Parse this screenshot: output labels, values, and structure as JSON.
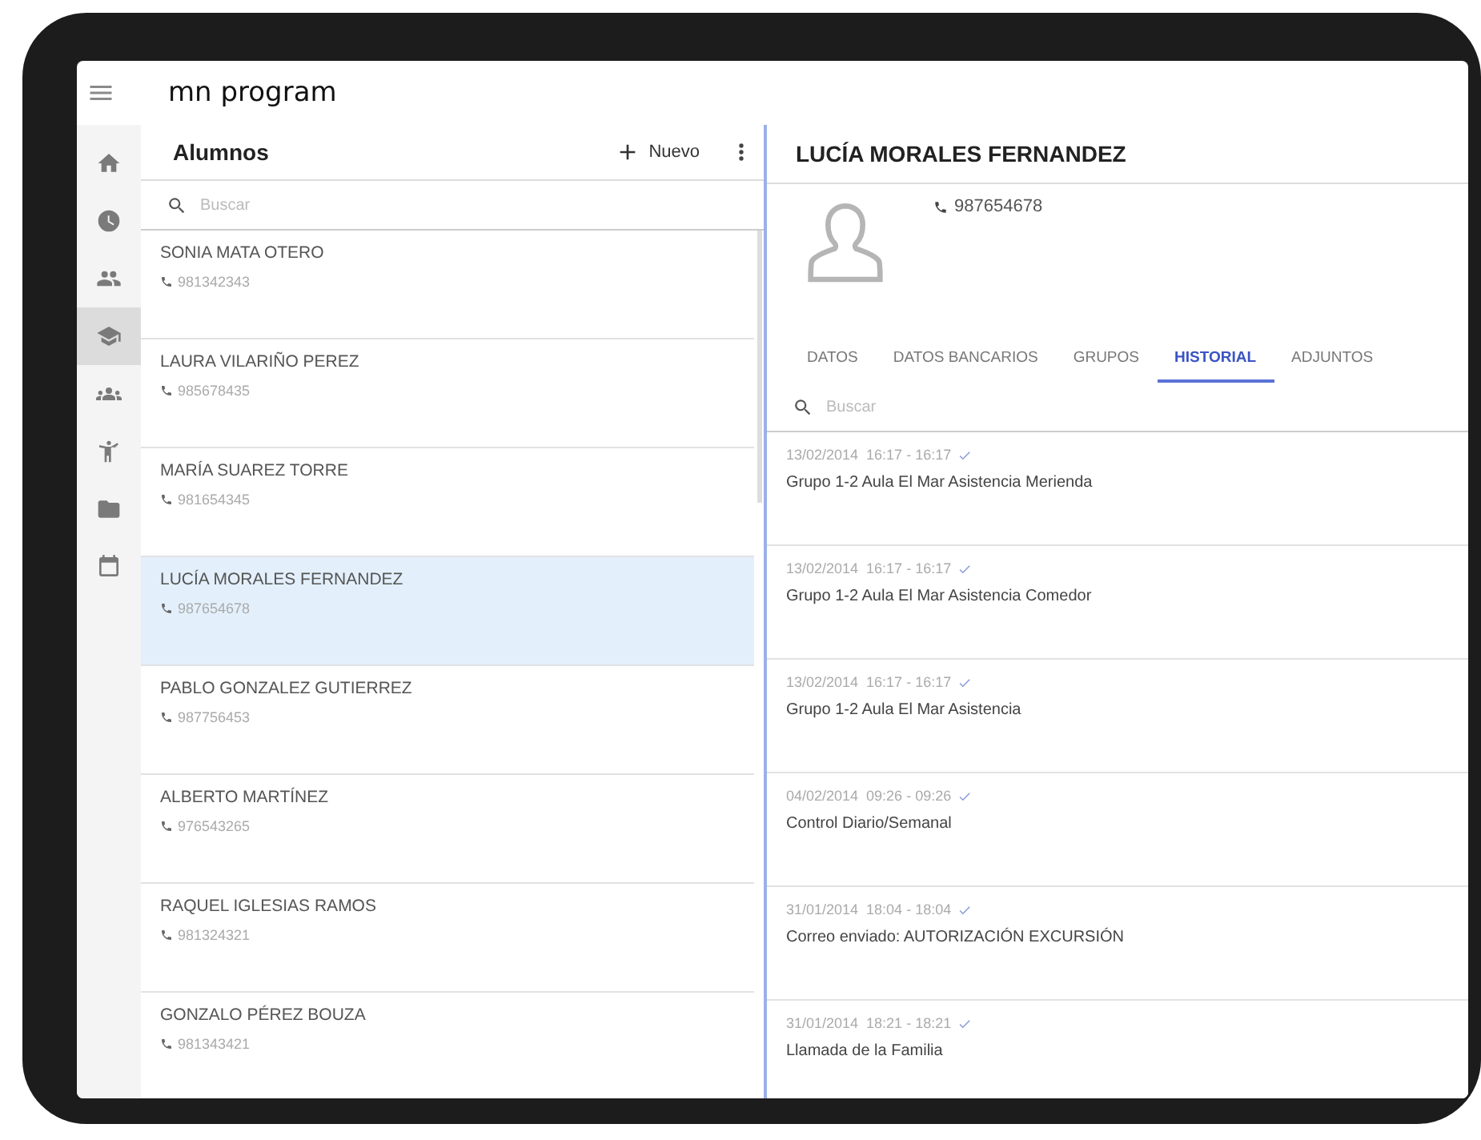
{
  "app": {
    "title": "mn program"
  },
  "rail": [
    {
      "selected": false
    },
    {
      "selected": false
    },
    {
      "selected": false
    },
    {
      "selected": true
    },
    {
      "selected": false
    },
    {
      "selected": false
    },
    {
      "selected": false
    },
    {
      "selected": false
    }
  ],
  "list": {
    "title": "Alumnos",
    "new_button": "Nuevo",
    "search": {
      "placeholder": "Buscar"
    },
    "items": [
      {
        "name": "SONIA MATA OTERO",
        "phone": "981342343",
        "selected": false
      },
      {
        "name": "LAURA VILARIÑO PEREZ",
        "phone": "985678435",
        "selected": false
      },
      {
        "name": "MARÍA SUAREZ TORRE",
        "phone": "981654345",
        "selected": false
      },
      {
        "name": "LUCÍA MORALES FERNANDEZ",
        "phone": "987654678",
        "selected": true
      },
      {
        "name": "PABLO GONZALEZ GUTIERREZ",
        "phone": "987756453",
        "selected": false
      },
      {
        "name": "ALBERTO MARTÍNEZ",
        "phone": "976543265",
        "selected": false
      },
      {
        "name": "RAQUEL IGLESIAS RAMOS",
        "phone": "981324321",
        "selected": false
      },
      {
        "name": "GONZALO PÉREZ BOUZA",
        "phone": "981343421",
        "selected": false
      }
    ]
  },
  "detail": {
    "name": "LUCÍA MORALES FERNANDEZ",
    "phone": "987654678",
    "tabs": [
      {
        "label": "DATOS",
        "selected": false
      },
      {
        "label": "DATOS BANCARIOS",
        "selected": false
      },
      {
        "label": "GRUPOS",
        "selected": false
      },
      {
        "label": "HISTORIAL",
        "selected": true
      },
      {
        "label": "ADJUNTOS",
        "selected": false
      }
    ],
    "search": {
      "placeholder": "Buscar"
    },
    "history": [
      {
        "time": "13/02/2014  16:17 - 16:17",
        "text": "Grupo 1-2 Aula El Mar Asistencia Merienda"
      },
      {
        "time": "13/02/2014  16:17 - 16:17",
        "text": "Grupo 1-2 Aula El Mar Asistencia Comedor"
      },
      {
        "time": "13/02/2014  16:17 - 16:17",
        "text": "Grupo 1-2 Aula El Mar Asistencia"
      },
      {
        "time": "04/02/2014  09:26 - 09:26",
        "text": "Control Diario/Semanal"
      },
      {
        "time": "31/01/2014  18:04 - 18:04",
        "text": "Correo enviado: AUTORIZACIÓN EXCURSIÓN"
      },
      {
        "time": "31/01/2014  18:21 - 18:21",
        "text": "Llamada de la Familia"
      }
    ]
  }
}
